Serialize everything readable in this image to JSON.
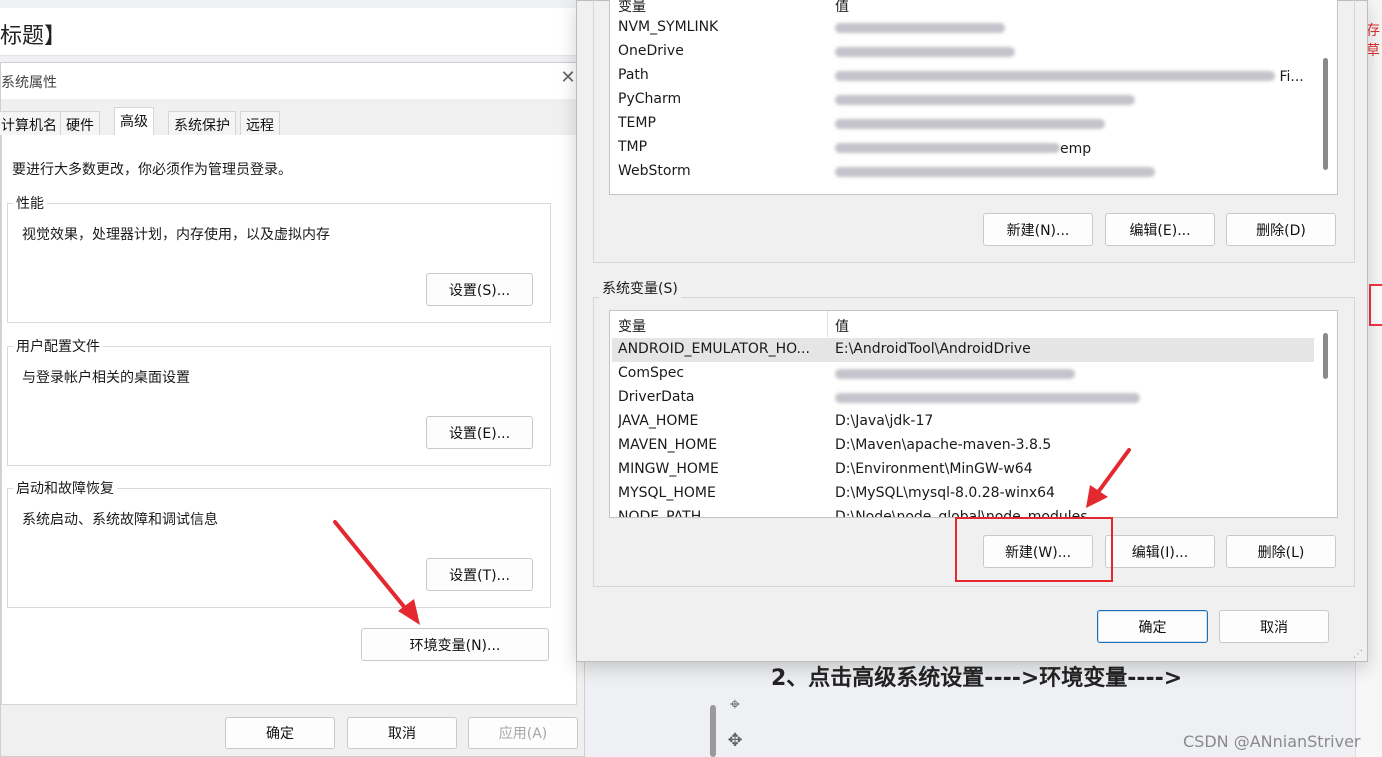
{
  "editor": {
    "title_fragment": "标题】"
  },
  "right_edge": {
    "red_fragment": "存草"
  },
  "system_properties": {
    "title": "系统属性",
    "close_glyph": "✕",
    "tabs": [
      "计算机名",
      "硬件",
      "高级",
      "系统保护",
      "远程"
    ],
    "active_tab": "高级",
    "admin_note": "要进行大多数更改，你必须作为管理员登录。",
    "groups": [
      {
        "legend": "性能",
        "description": "视觉效果，处理器计划，内存使用，以及虚拟内存",
        "button": "设置(S)..."
      },
      {
        "legend": "用户配置文件",
        "description": "与登录帐户相关的桌面设置",
        "button": "设置(E)..."
      },
      {
        "legend": "启动和故障恢复",
        "description": "系统启动、系统故障和调试信息",
        "button": "设置(T)..."
      }
    ],
    "env_button": "环境变量(N)...",
    "ok": "确定",
    "cancel": "取消",
    "apply": "应用(A)"
  },
  "environment_variables": {
    "user_vars": {
      "header_name": "变量",
      "header_value": "值",
      "rows": [
        {
          "name": "NVM_SYMLINK"
        },
        {
          "name": "OneDrive"
        },
        {
          "name": "Path",
          "value_suffix": "Fi..."
        },
        {
          "name": "PyCharm"
        },
        {
          "name": "TEMP"
        },
        {
          "name": "TMP",
          "value_suffix": "emp"
        },
        {
          "name": "WebStorm"
        }
      ],
      "buttons": {
        "new": "新建(N)...",
        "edit": "编辑(E)...",
        "delete": "删除(D)"
      }
    },
    "system_vars": {
      "legend": "系统变量(S)",
      "header_name": "变量",
      "header_value": "值",
      "rows": [
        {
          "name": "ANDROID_EMULATOR_HO...",
          "value": "E:\\AndroidTool\\AndroidDrive",
          "selected": true
        },
        {
          "name": "ComSpec",
          "value": ""
        },
        {
          "name": "DriverData",
          "value": ""
        },
        {
          "name": "JAVA_HOME",
          "value": "D:\\Java\\jdk-17"
        },
        {
          "name": "MAVEN_HOME",
          "value": "D:\\Maven\\apache-maven-3.8.5"
        },
        {
          "name": "MINGW_HOME",
          "value": "D:\\Environment\\MinGW-w64"
        },
        {
          "name": "MYSQL_HOME",
          "value": "D:\\MySQL\\mysql-8.0.28-winx64"
        },
        {
          "name": "NODE_PATH",
          "value": "D:\\Node\\node_global\\node_modules"
        }
      ],
      "buttons": {
        "new": "新建(W)...",
        "edit": "编辑(I)...",
        "delete": "删除(L)"
      }
    },
    "ok": "确定",
    "cancel": "取消"
  },
  "blog": {
    "step_text": "2、点击高级系统设置---->环境变量---->",
    "watermark": "CSDN @ANnianStriver"
  },
  "colors": {
    "annotation_red": "#e3282f",
    "selection_bg": "#e5e5e5"
  }
}
